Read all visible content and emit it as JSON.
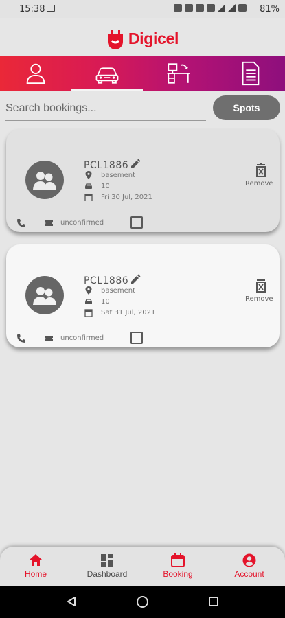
{
  "status_bar": {
    "time": "15:38",
    "battery": "81%"
  },
  "brand": {
    "name": "Digicel",
    "color": "#e4142b"
  },
  "top_tabs": [
    {
      "icon": "person-icon"
    },
    {
      "icon": "car-icon",
      "active": true
    },
    {
      "icon": "desk-icon"
    },
    {
      "icon": "document-icon"
    }
  ],
  "search": {
    "placeholder": "Search bookings...",
    "value": "",
    "button_label": "Spots"
  },
  "bookings": [
    {
      "code": "PCL1886",
      "location": "basement",
      "spot": "10",
      "date": "Fri 30 Jul, 2021",
      "status": "unconfirmed",
      "remove_label": "Remove",
      "checked": false
    },
    {
      "code": "PCL1886",
      "location": "basement",
      "spot": "10",
      "date": "Sat 31 Jul, 2021",
      "status": "unconfirmed",
      "remove_label": "Remove",
      "checked": false
    }
  ],
  "bottom_nav": [
    {
      "label": "Home",
      "icon": "home-icon"
    },
    {
      "label": "Dashboard",
      "icon": "dashboard-icon"
    },
    {
      "label": "Booking",
      "icon": "calendar-icon"
    },
    {
      "label": "Account",
      "icon": "account-icon"
    }
  ]
}
